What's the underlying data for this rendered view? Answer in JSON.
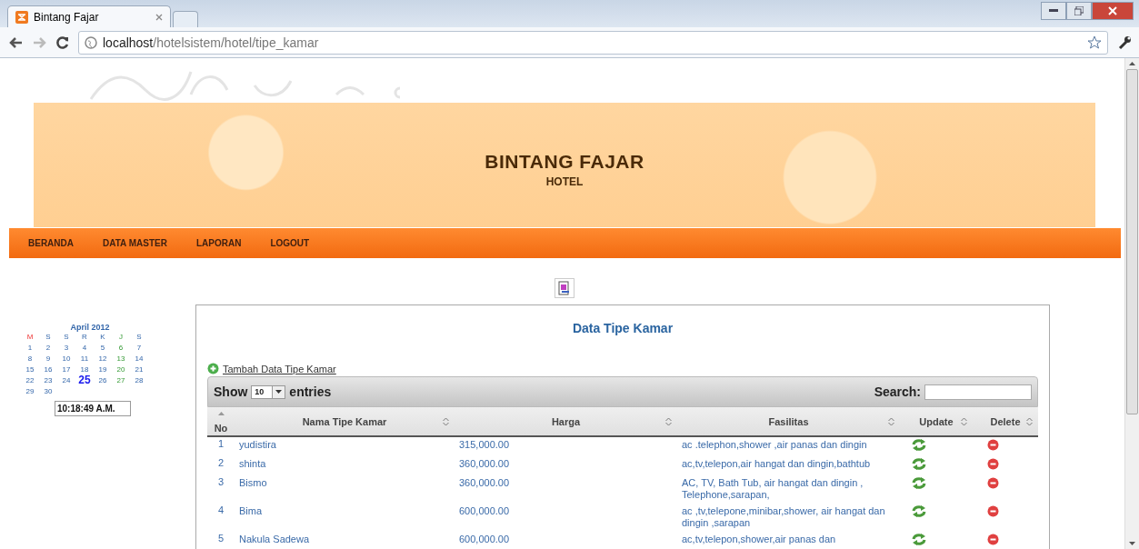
{
  "browser": {
    "tab_title": "Bintang Fajar",
    "address": {
      "host": "localhost",
      "path": "/hotelsistem/hotel/tipe_kamar"
    }
  },
  "header": {
    "title": "BINTANG FAJAR",
    "subtitle": "HOTEL"
  },
  "nav": {
    "items": [
      "BERANDA",
      "DATA MASTER",
      "LAPORAN",
      "LOGOUT"
    ]
  },
  "calendar": {
    "month": "April 2012",
    "weekdays": [
      {
        "label": "M",
        "kind": "sunday"
      },
      {
        "label": "S",
        "kind": "normal"
      },
      {
        "label": "S",
        "kind": "normal"
      },
      {
        "label": "R",
        "kind": "normal"
      },
      {
        "label": "K",
        "kind": "normal"
      },
      {
        "label": "J",
        "kind": "friday"
      },
      {
        "label": "S",
        "kind": "normal"
      }
    ],
    "days": [
      {
        "day": "1",
        "kind": "normal",
        "selected": false
      },
      {
        "day": "2",
        "kind": "normal",
        "selected": false
      },
      {
        "day": "3",
        "kind": "normal",
        "selected": false
      },
      {
        "day": "4",
        "kind": "normal",
        "selected": false
      },
      {
        "day": "5",
        "kind": "normal",
        "selected": false
      },
      {
        "day": "6",
        "kind": "friday",
        "selected": false
      },
      {
        "day": "7",
        "kind": "normal",
        "selected": false
      },
      {
        "day": "8",
        "kind": "normal",
        "selected": false
      },
      {
        "day": "9",
        "kind": "normal",
        "selected": false
      },
      {
        "day": "10",
        "kind": "normal",
        "selected": false
      },
      {
        "day": "11",
        "kind": "normal",
        "selected": false
      },
      {
        "day": "12",
        "kind": "normal",
        "selected": false
      },
      {
        "day": "13",
        "kind": "friday",
        "selected": false
      },
      {
        "day": "14",
        "kind": "normal",
        "selected": false
      },
      {
        "day": "15",
        "kind": "normal",
        "selected": false
      },
      {
        "day": "16",
        "kind": "normal",
        "selected": false
      },
      {
        "day": "17",
        "kind": "normal",
        "selected": false
      },
      {
        "day": "18",
        "kind": "normal",
        "selected": false
      },
      {
        "day": "19",
        "kind": "normal",
        "selected": false
      },
      {
        "day": "20",
        "kind": "friday",
        "selected": false
      },
      {
        "day": "21",
        "kind": "normal",
        "selected": false
      },
      {
        "day": "22",
        "kind": "normal",
        "selected": false
      },
      {
        "day": "23",
        "kind": "normal",
        "selected": false
      },
      {
        "day": "24",
        "kind": "normal",
        "selected": false
      },
      {
        "day": "25",
        "kind": "normal",
        "selected": true
      },
      {
        "day": "26",
        "kind": "normal",
        "selected": false
      },
      {
        "day": "27",
        "kind": "friday",
        "selected": false
      },
      {
        "day": "28",
        "kind": "normal",
        "selected": false
      },
      {
        "day": "29",
        "kind": "normal",
        "selected": false
      },
      {
        "day": "30",
        "kind": "normal",
        "selected": false
      }
    ],
    "clock": "10:18:49 A.M."
  },
  "content": {
    "title": "Data Tipe Kamar",
    "add_link": "Tambah Data Tipe Kamar",
    "table": {
      "show_label": "Show",
      "page_size": "10",
      "entries_label": "entries",
      "search_label": "Search:",
      "columns": [
        {
          "label": "No",
          "sorted": true
        },
        {
          "label": "Nama Tipe Kamar",
          "sorted": false
        },
        {
          "label": "Harga",
          "sorted": false
        },
        {
          "label": "Fasilitas",
          "sorted": false
        },
        {
          "label": "Update",
          "sorted": false
        },
        {
          "label": "Delete",
          "sorted": false
        }
      ],
      "rows": [
        {
          "no": "1",
          "nama": "yudistira",
          "harga": "315,000.00",
          "fasilitas": "ac .telephon,shower ,air panas dan dingin"
        },
        {
          "no": "2",
          "nama": "shinta",
          "harga": "360,000.00",
          "fasilitas": "ac,tv,telepon,air hangat dan dingin,bathtub"
        },
        {
          "no": "3",
          "nama": "Bismo",
          "harga": "360,000.00",
          "fasilitas": "AC, TV, Bath Tub, air hangat dan dingin , Telephone,sarapan,"
        },
        {
          "no": "4",
          "nama": "Bima",
          "harga": "600,000.00",
          "fasilitas": "ac ,tv,telepone,minibar,shower, air hangat dan dingin ,sarapan"
        },
        {
          "no": "5",
          "nama": "Nakula Sadewa",
          "harga": "600,000.00",
          "fasilitas": "ac,tv,telepon,shower,air panas dan"
        }
      ]
    }
  }
}
